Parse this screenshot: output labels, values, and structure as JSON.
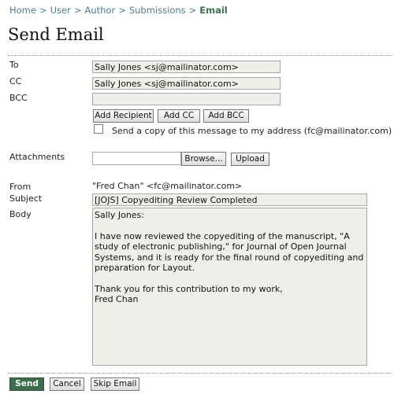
{
  "breadcrumb": {
    "items": [
      "Home",
      "User",
      "Author",
      "Submissions"
    ],
    "separator": ">",
    "current": "Email"
  },
  "page": {
    "title": "Send Email"
  },
  "form": {
    "to": {
      "label": "To",
      "value": "Sally Jones <sj@mailinator.com>"
    },
    "cc": {
      "label": "CC",
      "value": "Sally Jones <sj@mailinator.com>"
    },
    "bcc": {
      "label": "BCC",
      "value": ""
    },
    "buttons": {
      "add_recipient": "Add Recipient",
      "add_cc": "Add CC",
      "add_bcc": "Add BCC"
    },
    "copy_checkbox": {
      "label": "Send a copy of this message to my address (fc@mailinator.com)",
      "checked": false
    },
    "attachments": {
      "label": "Attachments",
      "value": "",
      "browse_label": "Browse...",
      "upload_label": "Upload"
    },
    "from": {
      "label": "From",
      "value": "\"Fred Chan\" <fc@mailinator.com>"
    },
    "subject": {
      "label": "Subject",
      "value": "[JOJS] Copyediting Review Completed"
    },
    "body": {
      "label": "Body",
      "value": "Sally Jones:\n\nI have now reviewed the copyediting of the manuscript, \"A study of electronic publishing,\" for Journal of Open Journal Systems, and it is ready for the final round of copyediting and preparation for Layout.\n\nThank you for this contribution to my work,\nFred Chan"
    }
  },
  "actions": {
    "send": "Send",
    "cancel": "Cancel",
    "skip_email": "Skip Email"
  },
  "colors": {
    "link": "#4b7d92",
    "accent_green": "#3c6e4a",
    "field_background": "#efefe9"
  }
}
